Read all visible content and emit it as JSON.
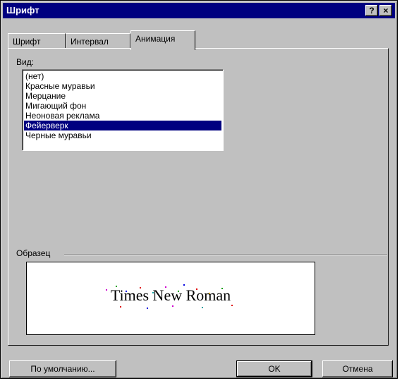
{
  "window": {
    "title": "Шрифт",
    "help_label": "?",
    "close_label": "×"
  },
  "tabs": [
    {
      "label": "Шрифт",
      "active": false
    },
    {
      "label": "Интервал",
      "active": false
    },
    {
      "label": "Анимация",
      "active": true
    }
  ],
  "animation": {
    "label": "Вид:",
    "items": [
      "(нет)",
      "Красные муравьи",
      "Мерцание",
      "Мигающий фон",
      "Неоновая реклама",
      "Фейерверк",
      "Черные муравьи"
    ],
    "selected_index": 5
  },
  "sample": {
    "label": "Образец",
    "text": "Times New Roman"
  },
  "buttons": {
    "default": "По умолчанию...",
    "ok": "OK",
    "cancel": "Отмена"
  },
  "colors": {
    "title_bar": "#000080",
    "face": "#c0c0c0",
    "selection": "#000080"
  }
}
